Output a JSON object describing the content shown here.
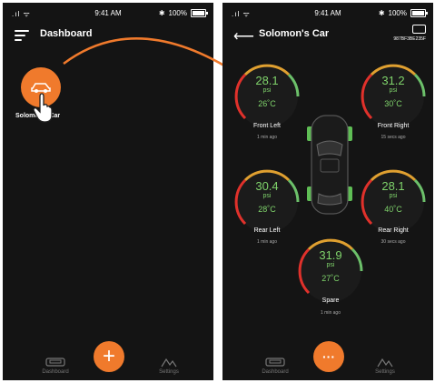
{
  "status": {
    "signal": ".ıl ᯤ",
    "time": "9:41 AM",
    "bluetooth": "✱",
    "battery": "100%"
  },
  "left": {
    "title": "Dashboard",
    "car": {
      "label": "Solomon's Car"
    },
    "tabs": {
      "dashboard": "Dashboard",
      "settings": "Settings",
      "fab": "+"
    }
  },
  "right": {
    "title": "Solomon's Car",
    "device_id": "987BF3BE235F",
    "tires": {
      "front_left": {
        "pressure": "28.1",
        "unit": "psi",
        "temp": "26˚C",
        "name": "Front Left",
        "updated": "1 min ago"
      },
      "front_right": {
        "pressure": "31.2",
        "unit": "psi",
        "temp": "30˚C",
        "name": "Front Right",
        "updated": "15 secs ago"
      },
      "rear_left": {
        "pressure": "30.4",
        "unit": "psi",
        "temp": "28˚C",
        "name": "Rear Left",
        "updated": "1 min ago"
      },
      "rear_right": {
        "pressure": "28.1",
        "unit": "psi",
        "temp": "40˚C",
        "name": "Rear Right",
        "updated": "30 secs ago"
      },
      "spare": {
        "pressure": "31.9",
        "unit": "psi",
        "temp": "27˚C",
        "name": "Spare",
        "updated": "1 min ago"
      }
    },
    "tabs": {
      "dashboard": "Dashboard",
      "settings": "Settings",
      "fab": "···"
    }
  },
  "colors": {
    "accent": "#f07a2c",
    "value": "#7fd36b",
    "background": "#141414"
  }
}
